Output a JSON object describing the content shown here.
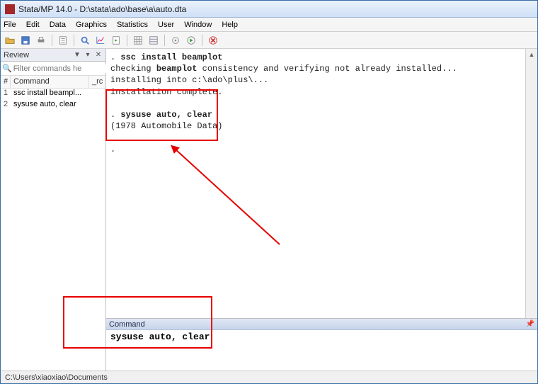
{
  "title": "Stata/MP 14.0 - D:\\stata\\ado\\base\\a\\auto.dta",
  "menu": [
    "File",
    "Edit",
    "Data",
    "Graphics",
    "Statistics",
    "User",
    "Window",
    "Help"
  ],
  "review": {
    "title": "Review",
    "filter_placeholder": "Filter commands he",
    "cols": {
      "num": "#",
      "cmd": "Command",
      "rc": "_rc"
    },
    "rows": [
      {
        "n": "1",
        "cmd": "ssc install beampl..."
      },
      {
        "n": "2",
        "cmd": "sysuse auto, clear"
      }
    ]
  },
  "results": {
    "l1a": ". ",
    "l1b": "ssc install beamplot",
    "l2a": "checking ",
    "l2b": "beamplot",
    "l2c": " consistency and verifying not already installed...",
    "l3": "installing into c:\\ado\\plus\\...",
    "l4": "installation complete.",
    "l5a": ". ",
    "l5b": "sysuse auto, clear",
    "l6": "(1978 Automobile Data)",
    "l7": "."
  },
  "command": {
    "title": "Command",
    "value": "sysuse auto, clear"
  },
  "status": "C:\\Users\\xiaoxiao\\Documents"
}
